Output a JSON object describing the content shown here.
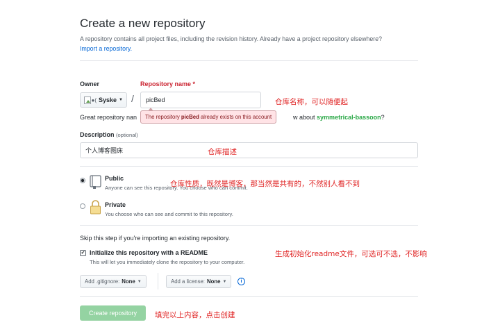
{
  "header": {
    "title": "Create a new repository",
    "intro": "A repository contains all project files, including the revision history. Already have a project repository elsewhere?",
    "import_link": "Import a repository."
  },
  "owner": {
    "label": "Owner",
    "img_alt": "●(",
    "name": "Syske"
  },
  "repo_name": {
    "label": "Repository name",
    "required_mark": "*",
    "value": "picBed",
    "error_prefix": "The repository",
    "error_name": "picBed",
    "error_suffix": "already exists on this account",
    "suggest_left": "Great repository nan",
    "suggest_right_prefix": "w about",
    "suggest_name": "symmetrical-bassoon",
    "suggest_right_suffix": "?"
  },
  "description": {
    "label": "Description",
    "optional": "(optional)",
    "value": "个人博客图床"
  },
  "visibility": {
    "public_title": "Public",
    "public_desc": "Anyone can see this repository. You choose who can commit.",
    "private_title": "Private",
    "private_desc": "You choose who can see and commit to this repository."
  },
  "init": {
    "skip_text": "Skip this step if you're importing an existing repository.",
    "readme_label": "Initialize this repository with a README",
    "readme_desc": "This will let you immediately clone the repository to your computer.",
    "readme_checked": true
  },
  "selects": {
    "gitignore_label": "Add .gitignore:",
    "gitignore_value": "None",
    "license_label": "Add a license:",
    "license_value": "None"
  },
  "submit": {
    "label": "Create repository"
  },
  "annotations": {
    "repo_name_note": "仓库名称，可以随便起",
    "description_note": "仓库描述",
    "visibility_note": "仓库性质，既然是博客，那当然是共有的，不然别人看不到",
    "readme_note": "生成初始化readme文件，可选可不选，不影响",
    "submit_note": "填完以上内容，点击创建"
  },
  "colors": {
    "annotation": "#e02424",
    "link": "#0366d6",
    "required": "#cb2431",
    "suggestion": "#28a745",
    "create_button": "#94d3a2"
  },
  "icons": [
    "caret-down-icon",
    "repo-book-icon",
    "lock-icon",
    "check-icon",
    "info-icon",
    "broken-avatar-icon"
  ]
}
